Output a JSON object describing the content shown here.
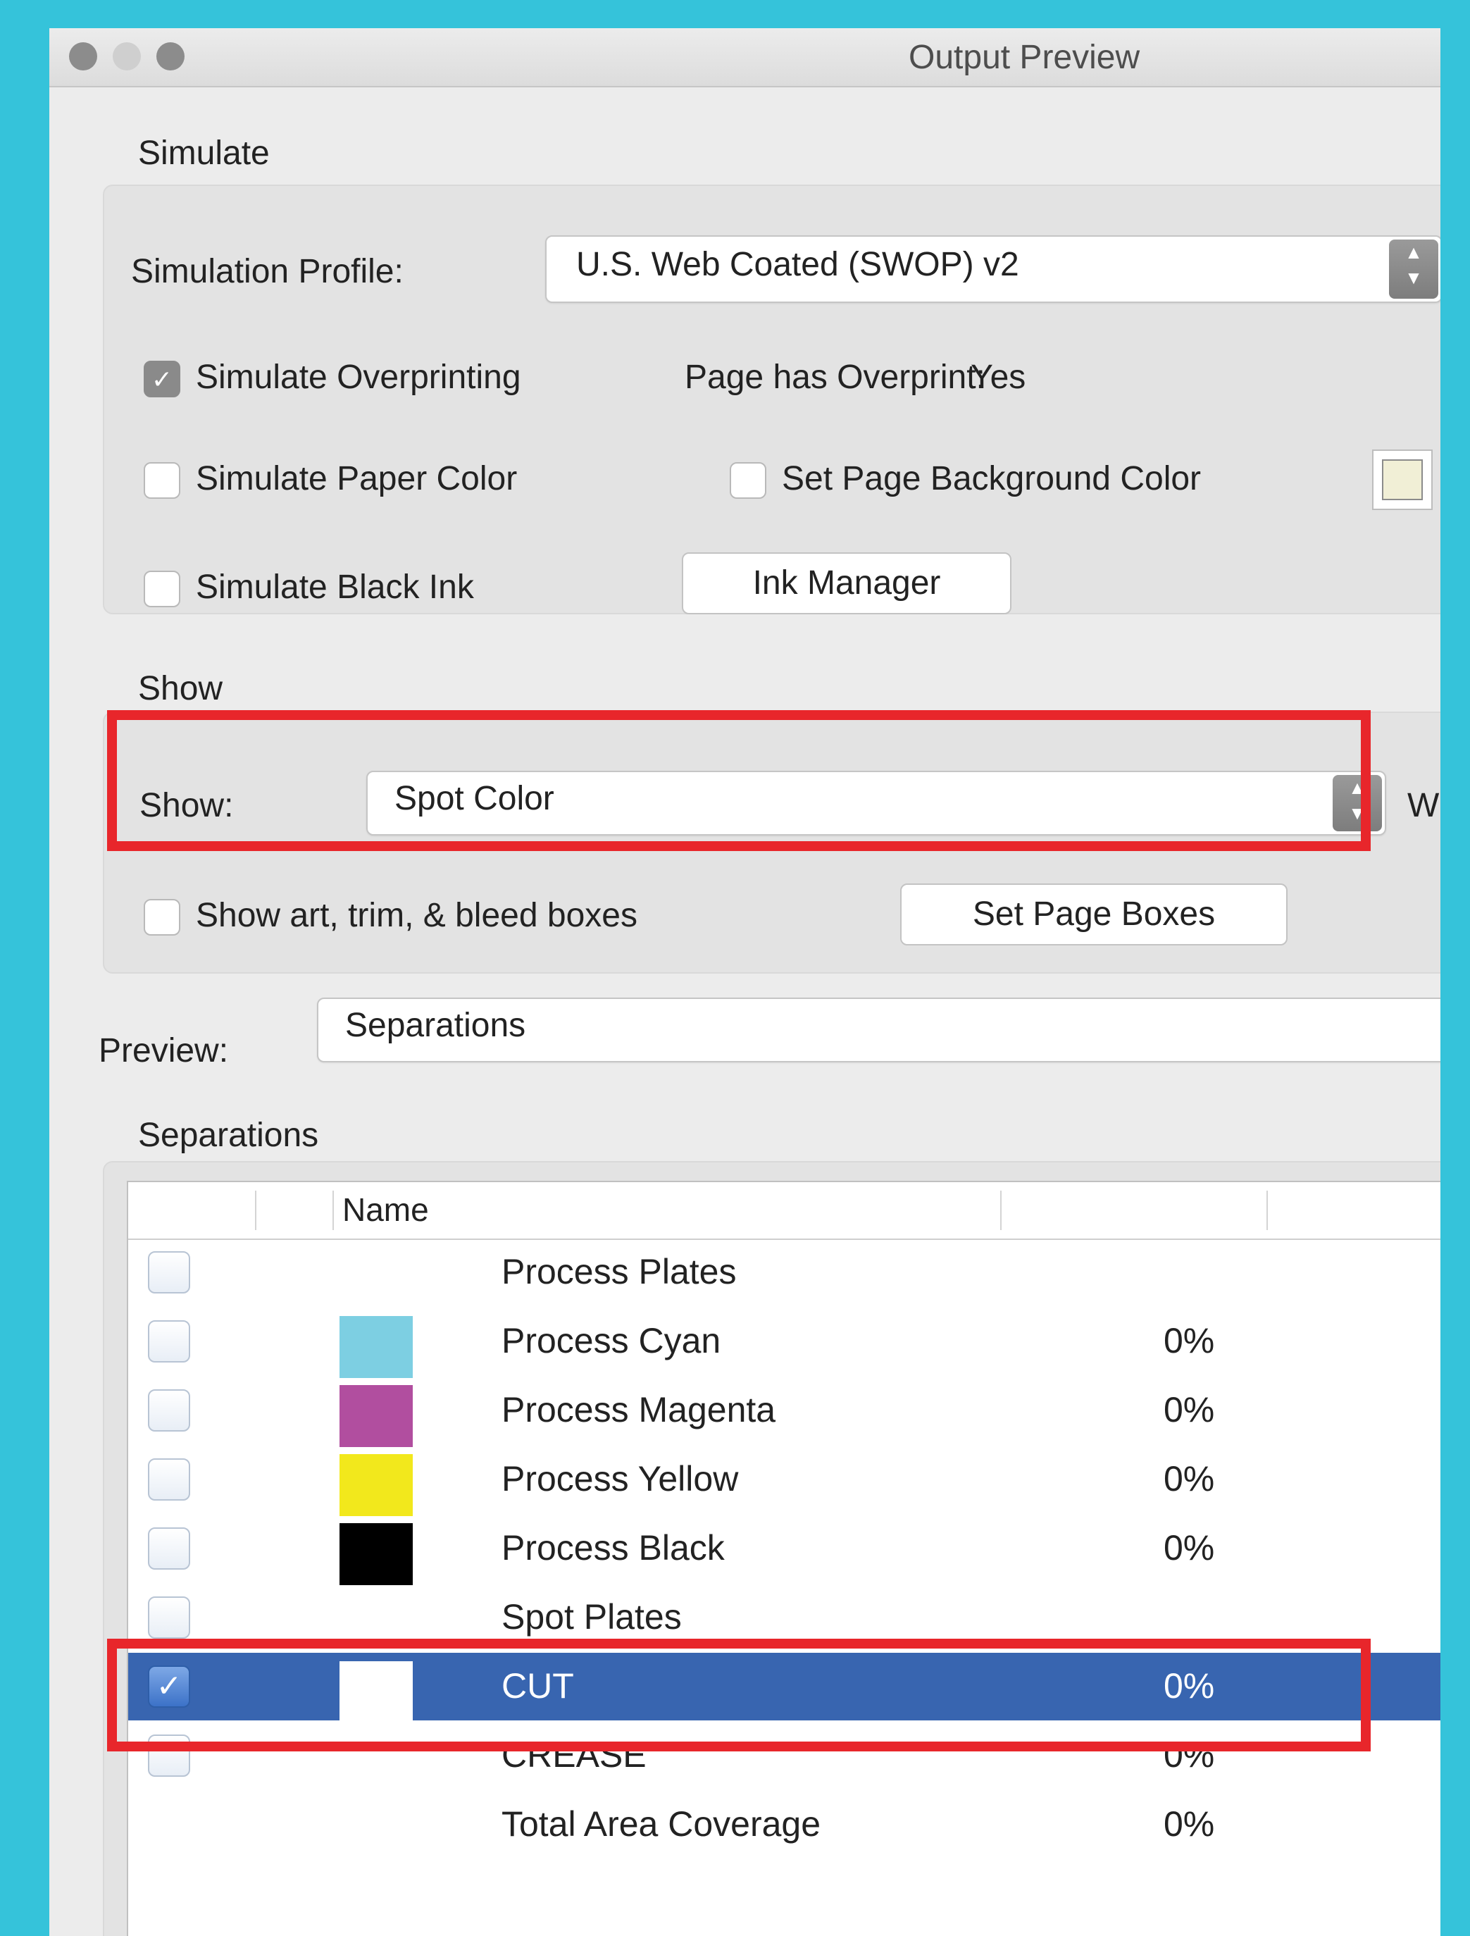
{
  "window": {
    "title": "Output Preview",
    "traffic_lights": [
      "#8c8c8c",
      "#cfcfcf",
      "#8c8c8c"
    ]
  },
  "simulate": {
    "section_label": "Simulate",
    "profile_label": "Simulation Profile:",
    "profile_value": "U.S. Web Coated (SWOP) v2",
    "overprint_label": "Simulate Overprinting",
    "overprint_checked": true,
    "page_overprint_label": "Page has Overprint:",
    "page_overprint_value": "Yes",
    "paper_color_label": "Simulate Paper Color",
    "page_bg_label": "Set Page Background Color",
    "black_ink_label": "Simulate Black Ink",
    "ink_manager_label": "Ink Manager"
  },
  "show": {
    "section_label": "Show",
    "show_label": "Show:",
    "show_value": "Spot Color",
    "cut_off_text": "W",
    "boxes_label": "Show art, trim, & bleed boxes",
    "set_boxes_label": "Set Page Boxes"
  },
  "preview": {
    "label": "Preview:",
    "value": "Separations"
  },
  "separations": {
    "section_label": "Separations",
    "column_name": "Name",
    "rows": [
      {
        "name": "Process Plates",
        "pct": "",
        "swatch": null,
        "checked": false
      },
      {
        "name": "Process Cyan",
        "pct": "0%",
        "swatch": "#7dcfe2",
        "checked": false
      },
      {
        "name": "Process Magenta",
        "pct": "0%",
        "swatch": "#b14e9f",
        "checked": false
      },
      {
        "name": "Process Yellow",
        "pct": "0%",
        "swatch": "#f2e81c",
        "checked": false
      },
      {
        "name": "Process Black",
        "pct": "0%",
        "swatch": "#000000",
        "checked": false
      },
      {
        "name": "Spot Plates",
        "pct": "",
        "swatch": null,
        "checked": false
      },
      {
        "name": "CUT",
        "pct": "0%",
        "swatch": "#ffffff",
        "checked": true
      },
      {
        "name": "CREASE",
        "pct": "0%",
        "swatch": null,
        "checked": false
      },
      {
        "name": "Total Area Coverage",
        "pct": "0%",
        "swatch": null,
        "checked": null
      }
    ]
  },
  "colors": {
    "highlight": "#e8262b",
    "selection": "#3865b0",
    "background": "#35c3da"
  }
}
